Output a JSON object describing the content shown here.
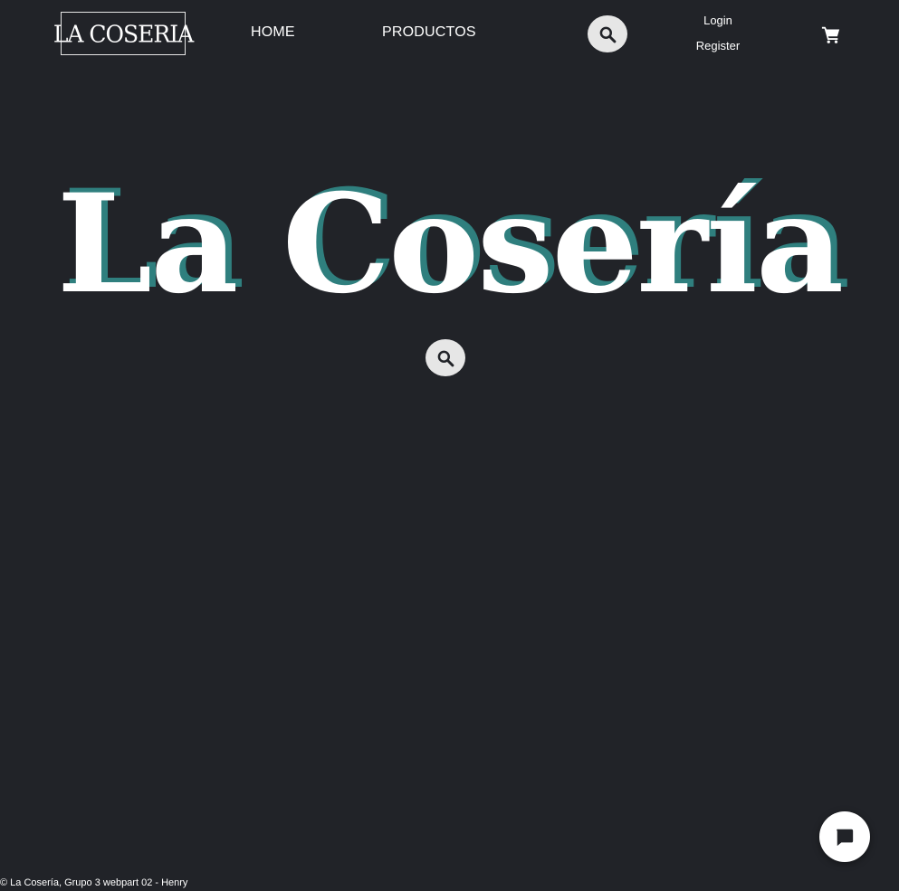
{
  "header": {
    "logo_text": "LA COSERIA",
    "nav": {
      "home": "HOME",
      "productos": "PRODUCTOS"
    },
    "auth": {
      "login": "Login",
      "register": "Register"
    },
    "icons": {
      "search": "search-icon",
      "cart": "cart-icon"
    }
  },
  "hero": {
    "title": "La Cosería",
    "search_icon": "search-icon"
  },
  "footer": {
    "text": "© La Cosería, Grupo 3 webpart 02 - Henry"
  },
  "chat": {
    "icon": "chat-bubble-icon"
  },
  "colors": {
    "background": "#212328",
    "accent": "#2f7f7e",
    "button_bg": "#e6e6e6",
    "text": "#ffffff"
  }
}
